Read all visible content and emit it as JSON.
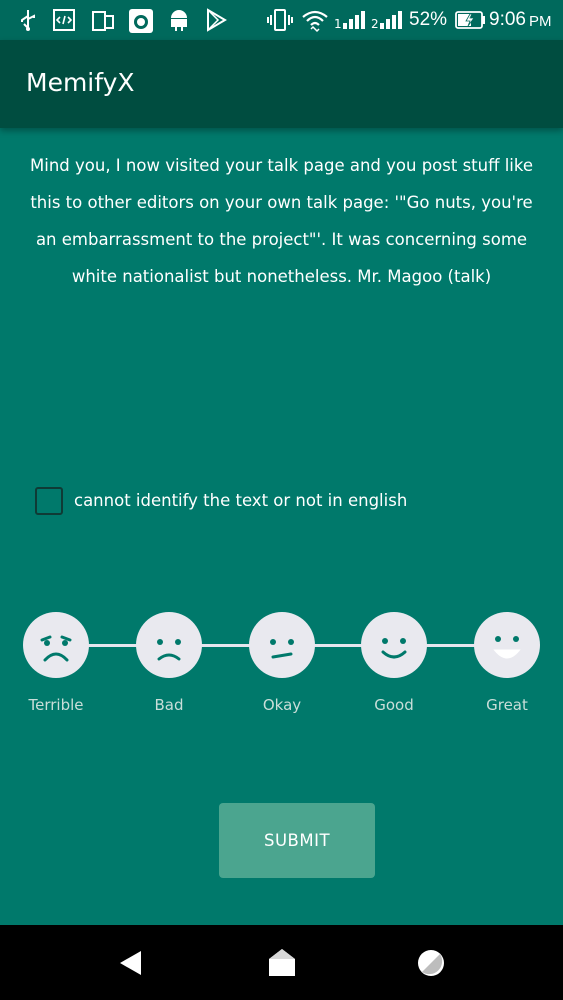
{
  "status_bar": {
    "battery_percent": "52%",
    "time": "9:06",
    "time_suffix": "PM",
    "icons": [
      "usb-icon",
      "code-icon",
      "screen-rotation-icon",
      "camera-app-icon",
      "android-icon",
      "play-store-icon",
      "vibrate-icon",
      "wifi-icon",
      "signal-1-icon",
      "signal-2-icon",
      "battery-charging-icon"
    ]
  },
  "app_bar": {
    "title": "MemifyX"
  },
  "comment": {
    "text": "Mind you, I now visited your talk page and you post stuff like this to other editors on your own talk page: '\"Go nuts, you're an embarrassment to the project\"'. It was concerning some white nationalist but nonetheless. Mr. Magoo (talk)"
  },
  "checkbox": {
    "label": "cannot identify the text or not in english",
    "checked": false
  },
  "rating": {
    "options": [
      {
        "label": "Terrible",
        "icon": "face-terrible-icon"
      },
      {
        "label": "Bad",
        "icon": "face-bad-icon"
      },
      {
        "label": "Okay",
        "icon": "face-okay-icon"
      },
      {
        "label": "Good",
        "icon": "face-good-icon"
      },
      {
        "label": "Great",
        "icon": "face-great-icon"
      }
    ]
  },
  "submit": {
    "label": "SUBMIT"
  },
  "nav_bar": {
    "icons": [
      "back-icon",
      "home-icon",
      "recents-icon"
    ]
  },
  "colors": {
    "background": "#00796b",
    "app_bar": "#004d40",
    "status_bar": "#00695c",
    "submit": "#4ba58f",
    "face": "#e9e9ef"
  }
}
